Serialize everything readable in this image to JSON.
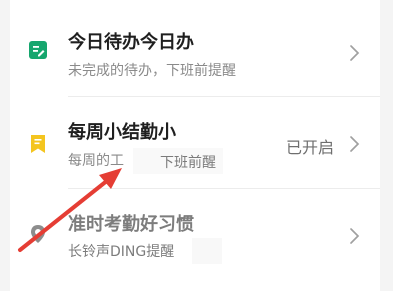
{
  "items": [
    {
      "title": "今日待办今日办",
      "subtitle": "未完成的待办，下班前提醒",
      "status": "",
      "icon": "clipboard-edit-icon",
      "chevron_icon": "chevron-right-icon"
    },
    {
      "title": "每周小结勤小",
      "subtitle": "每周的工",
      "status": "已开启",
      "icon": "bookmark-icon",
      "chevron_icon": "chevron-right-icon"
    },
    {
      "title": "准时考勤好习惯",
      "subtitle": "长铃声DING提醒",
      "status": "",
      "icon": "map-pin-icon",
      "chevron_icon": "chevron-right-icon"
    }
  ],
  "overlay": {
    "text": "下班前醒"
  },
  "colors": {
    "green_icon": "#16a66e",
    "yellow_icon": "#f4c51f",
    "gray_icon": "#8d8d8d",
    "arrow_red": "#e53d34"
  }
}
